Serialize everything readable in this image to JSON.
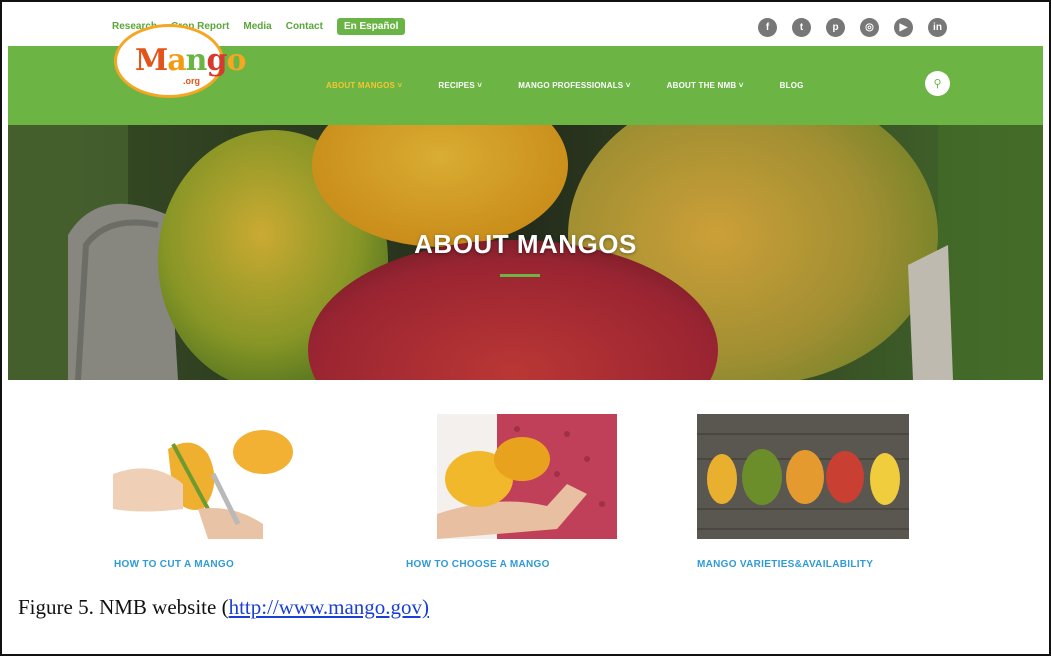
{
  "top_bar": {
    "links": [
      "Research",
      "Crop Report",
      "Media",
      "Contact"
    ],
    "language_button": "En Español",
    "social_icons": [
      "facebook-icon",
      "twitter-icon",
      "pinterest-icon",
      "instagram-icon",
      "youtube-icon",
      "linkedin-icon"
    ]
  },
  "nav": {
    "logo_main": "Mango",
    "logo_sub": ".org",
    "items": [
      {
        "label": "ABOUT MANGOS ˅",
        "active": true
      },
      {
        "label": "RECIPES ˅",
        "active": false
      },
      {
        "label": "MANGO PROFESSIONALS ˅",
        "active": false
      },
      {
        "label": "ABOUT THE NMB ˅",
        "active": false
      },
      {
        "label": "BLOG",
        "active": false
      }
    ],
    "search_icon": "search-icon"
  },
  "hero": {
    "title": "ABOUT MANGOS"
  },
  "cards": [
    {
      "label": "HOW TO CUT A MANGO"
    },
    {
      "label": "HOW TO CHOOSE A MANGO"
    },
    {
      "label": "MANGO VARIETIES&AVAILABILITY"
    }
  ],
  "caption": {
    "text": "Figure 5. NMB website (",
    "link": "http://www.mango.gov)"
  },
  "colors": {
    "brand_green": "#6cb444",
    "accent_yellow": "#f7c531",
    "link_blue": "#2f9bd6"
  }
}
